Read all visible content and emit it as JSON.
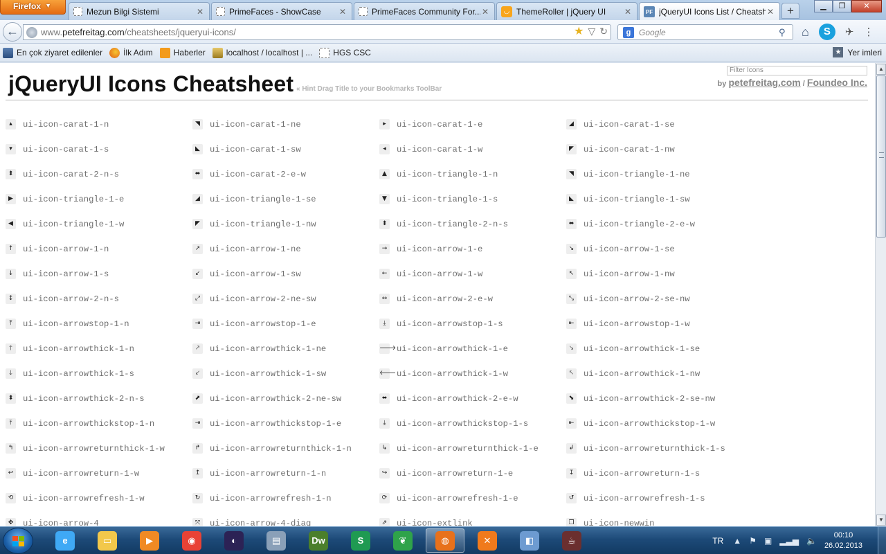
{
  "browser": {
    "app_menu_label": "Firefox",
    "tabs": [
      {
        "label": "Mezun Bilgi Sistemi",
        "favicon": "blank-page-icon"
      },
      {
        "label": "PrimeFaces - ShowCase",
        "favicon": "blank-page-icon"
      },
      {
        "label": "PrimeFaces Community For...",
        "favicon": "blank-page-icon"
      },
      {
        "label": "ThemeRoller | jQuery UI",
        "favicon": "themeroller-icon"
      },
      {
        "label": "jQueryUI Icons List / Cheatsh...",
        "favicon": "primefaces-icon",
        "active": true
      }
    ],
    "url": {
      "scheme": "www.",
      "host": "petefreitag.com",
      "path": "/cheatsheets/jqueryui-icons/"
    },
    "search_placeholder": "Google",
    "bookmarks": [
      {
        "label": "En çok ziyaret edilenler",
        "icon": "most-visited-icon"
      },
      {
        "label": "İlk Adım",
        "icon": "firefox-icon"
      },
      {
        "label": "Haberler",
        "icon": "rss-icon"
      },
      {
        "label": "localhost / localhost | ...",
        "icon": "phpmyadmin-icon"
      },
      {
        "label": "HGS CSC",
        "icon": "blank-page-icon"
      }
    ],
    "bookmarks_menu_label": "Yer imleri"
  },
  "page": {
    "title": "jQueryUI Icons Cheatsheet",
    "hint": "« Hint Drag Title to your Bookmarks ToolBar",
    "filter_placeholder": "Filter Icons",
    "by_label": "by",
    "author_link": "petefreitag.com",
    "separator": "/",
    "company_link": "Foundeo Inc.",
    "icons": [
      [
        "ui-icon-carat-1-n",
        "ui-icon-carat-1-ne",
        "ui-icon-carat-1-e",
        "ui-icon-carat-1-se"
      ],
      [
        "ui-icon-carat-1-s",
        "ui-icon-carat-1-sw",
        "ui-icon-carat-1-w",
        "ui-icon-carat-1-nw"
      ],
      [
        "ui-icon-carat-2-n-s",
        "ui-icon-carat-2-e-w",
        "ui-icon-triangle-1-n",
        "ui-icon-triangle-1-ne"
      ],
      [
        "ui-icon-triangle-1-e",
        "ui-icon-triangle-1-se",
        "ui-icon-triangle-1-s",
        "ui-icon-triangle-1-sw"
      ],
      [
        "ui-icon-triangle-1-w",
        "ui-icon-triangle-1-nw",
        "ui-icon-triangle-2-n-s",
        "ui-icon-triangle-2-e-w"
      ],
      [
        "ui-icon-arrow-1-n",
        "ui-icon-arrow-1-ne",
        "ui-icon-arrow-1-e",
        "ui-icon-arrow-1-se"
      ],
      [
        "ui-icon-arrow-1-s",
        "ui-icon-arrow-1-sw",
        "ui-icon-arrow-1-w",
        "ui-icon-arrow-1-nw"
      ],
      [
        "ui-icon-arrow-2-n-s",
        "ui-icon-arrow-2-ne-sw",
        "ui-icon-arrow-2-e-w",
        "ui-icon-arrow-2-se-nw"
      ],
      [
        "ui-icon-arrowstop-1-n",
        "ui-icon-arrowstop-1-e",
        "ui-icon-arrowstop-1-s",
        "ui-icon-arrowstop-1-w"
      ],
      [
        "ui-icon-arrowthick-1-n",
        "ui-icon-arrowthick-1-ne",
        "ui-icon-arrowthick-1-e",
        "ui-icon-arrowthick-1-se"
      ],
      [
        "ui-icon-arrowthick-1-s",
        "ui-icon-arrowthick-1-sw",
        "ui-icon-arrowthick-1-w",
        "ui-icon-arrowthick-1-nw"
      ],
      [
        "ui-icon-arrowthick-2-n-s",
        "ui-icon-arrowthick-2-ne-sw",
        "ui-icon-arrowthick-2-e-w",
        "ui-icon-arrowthick-2-se-nw"
      ],
      [
        "ui-icon-arrowthickstop-1-n",
        "ui-icon-arrowthickstop-1-e",
        "ui-icon-arrowthickstop-1-s",
        "ui-icon-arrowthickstop-1-w"
      ],
      [
        "ui-icon-arrowreturnthick-1-w",
        "ui-icon-arrowreturnthick-1-n",
        "ui-icon-arrowreturnthick-1-e",
        "ui-icon-arrowreturnthick-1-s"
      ],
      [
        "ui-icon-arrowreturn-1-w",
        "ui-icon-arrowreturn-1-n",
        "ui-icon-arrowreturn-1-e",
        "ui-icon-arrowreturn-1-s"
      ],
      [
        "ui-icon-arrowrefresh-1-w",
        "ui-icon-arrowrefresh-1-n",
        "ui-icon-arrowrefresh-1-e",
        "ui-icon-arrowrefresh-1-s"
      ],
      [
        "ui-icon-arrow-4",
        "ui-icon-arrow-4-diag",
        "ui-icon-extlink",
        "ui-icon-newwin"
      ]
    ],
    "glyphs": [
      [
        "▴",
        "◥",
        "▸",
        "◢"
      ],
      [
        "▾",
        "◣",
        "◂",
        "◤"
      ],
      [
        "⬍",
        "⬌",
        "▲",
        "◥"
      ],
      [
        "▶",
        "◢",
        "▼",
        "◣"
      ],
      [
        "◀",
        "◤",
        "⬍",
        "⬌"
      ],
      [
        "↑",
        "↗",
        "→",
        "↘"
      ],
      [
        "↓",
        "↙",
        "←",
        "↖"
      ],
      [
        "↕",
        "⤢",
        "↔",
        "⤡"
      ],
      [
        "⤒",
        "⇥",
        "⤓",
        "⇤"
      ],
      [
        "🡑",
        "🡕",
        "🡒",
        "🡖"
      ],
      [
        "🡓",
        "🡗",
        "🡐",
        "🡔"
      ],
      [
        "⬍",
        "⬈",
        "⬌",
        "⬊"
      ],
      [
        "⤒",
        "⇥",
        "⤓",
        "⇤"
      ],
      [
        "↰",
        "↱",
        "↳",
        "↲"
      ],
      [
        "↩",
        "↥",
        "↪",
        "↧"
      ],
      [
        "⟲",
        "↻",
        "⟳",
        "↺"
      ],
      [
        "✥",
        "⤧",
        "⇗",
        "❐"
      ]
    ]
  },
  "taskbar": {
    "apps": [
      {
        "name": "internet-explorer-icon",
        "glyph": "e",
        "color": "#3fa9f5"
      },
      {
        "name": "file-explorer-icon",
        "glyph": "▭",
        "color": "#f2c84b"
      },
      {
        "name": "media-player-icon",
        "glyph": "▶",
        "color": "#f08a24"
      },
      {
        "name": "chrome-icon",
        "glyph": "◉",
        "color": "#e94235"
      },
      {
        "name": "eclipse-icon",
        "glyph": "◐",
        "color": "#2c2255"
      },
      {
        "name": "database-tool-icon",
        "glyph": "▤",
        "color": "#8aa0b8"
      },
      {
        "name": "dreamweaver-icon",
        "glyph": "Dw",
        "color": "#4b7f2b"
      },
      {
        "name": "sync-tool-icon",
        "glyph": "S",
        "color": "#1f9a52"
      },
      {
        "name": "leaf-app-icon",
        "glyph": "❦",
        "color": "#2fa34a"
      },
      {
        "name": "firefox-icon",
        "glyph": "◍",
        "color": "#e8711b",
        "active": true
      },
      {
        "name": "xampp-icon",
        "glyph": "✕",
        "color": "#f07a1c"
      },
      {
        "name": "virtualbox-icon",
        "glyph": "◧",
        "color": "#6d9bd1"
      },
      {
        "name": "java-ee-ide-icon",
        "glyph": "☕",
        "color": "#6b2f2f"
      }
    ],
    "language": "TR",
    "time": "00:10",
    "date": "26.02.2013"
  }
}
